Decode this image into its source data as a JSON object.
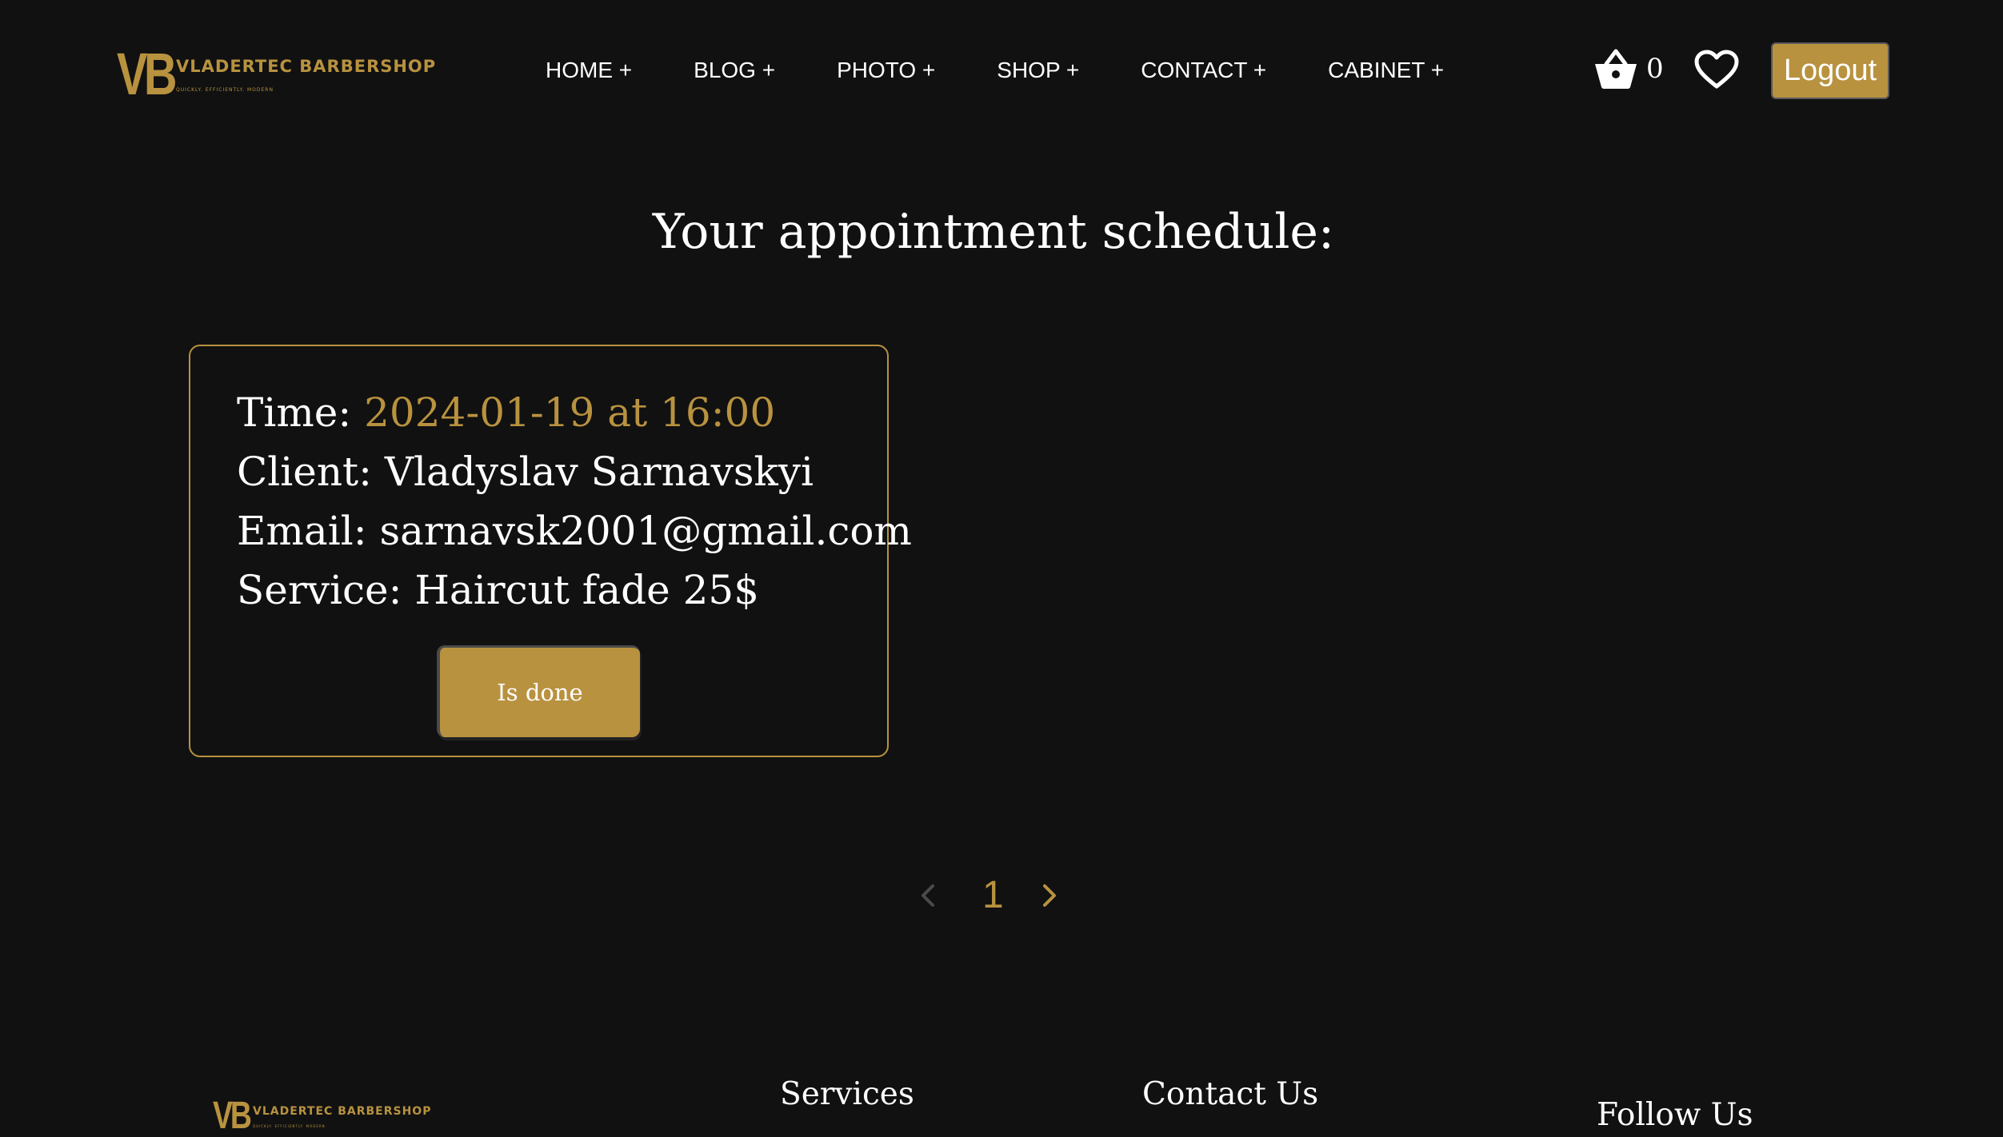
{
  "header": {
    "logo_mark": "VB",
    "logo_name": "VLADERTEC BARBERSHOP",
    "logo_tagline": "QUICKLY. EFFICIENTLY. MODERN",
    "nav": [
      "HOME +",
      "BLOG +",
      "PHOTO +",
      "SHOP +",
      "CONTACT +",
      "CABINET +"
    ],
    "cart_count": "0",
    "logout_label": "Logout"
  },
  "main": {
    "title": "Your appointment schedule:",
    "appointment": {
      "time_label": "Time: ",
      "time_value": "2024-01-19 at 16:00",
      "client": "Client: Vladyslav Sarnavskyi",
      "email": "Email: sarnavsk2001@gmail.com",
      "service": "Service: Haircut fade 25$",
      "done_label": "Is done"
    },
    "pagination": {
      "current_page": "1"
    }
  },
  "footer": {
    "logo_mark": "VB",
    "logo_name": "VLADERTEC BARBERSHOP",
    "logo_tagline": "QUICKLY. EFFICIENTLY. MODERN",
    "services_heading": "Services",
    "contact_heading": "Contact Us",
    "follow_heading": "Follow Us"
  },
  "colors": {
    "background": "#111111",
    "accent": "#b8923f",
    "text": "#ffffff"
  },
  "icons": {
    "cart": "basket-icon",
    "wishlist": "heart-icon",
    "prev": "chevron-left-icon",
    "next": "chevron-right-icon"
  }
}
